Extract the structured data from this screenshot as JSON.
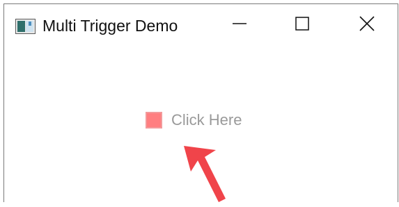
{
  "window": {
    "title": "Multi Trigger Demo"
  },
  "title_buttons": {
    "minimize_icon": "minimize-icon",
    "maximize_icon": "maximize-icon",
    "close_icon": "close-icon"
  },
  "checkbox": {
    "label": "Click Here",
    "checked": false,
    "box_color": "#ff7e80",
    "label_color": "#9a9a9a"
  },
  "annotation": {
    "arrow_color": "#f0444a",
    "icon": "arrow-annotation-icon"
  }
}
